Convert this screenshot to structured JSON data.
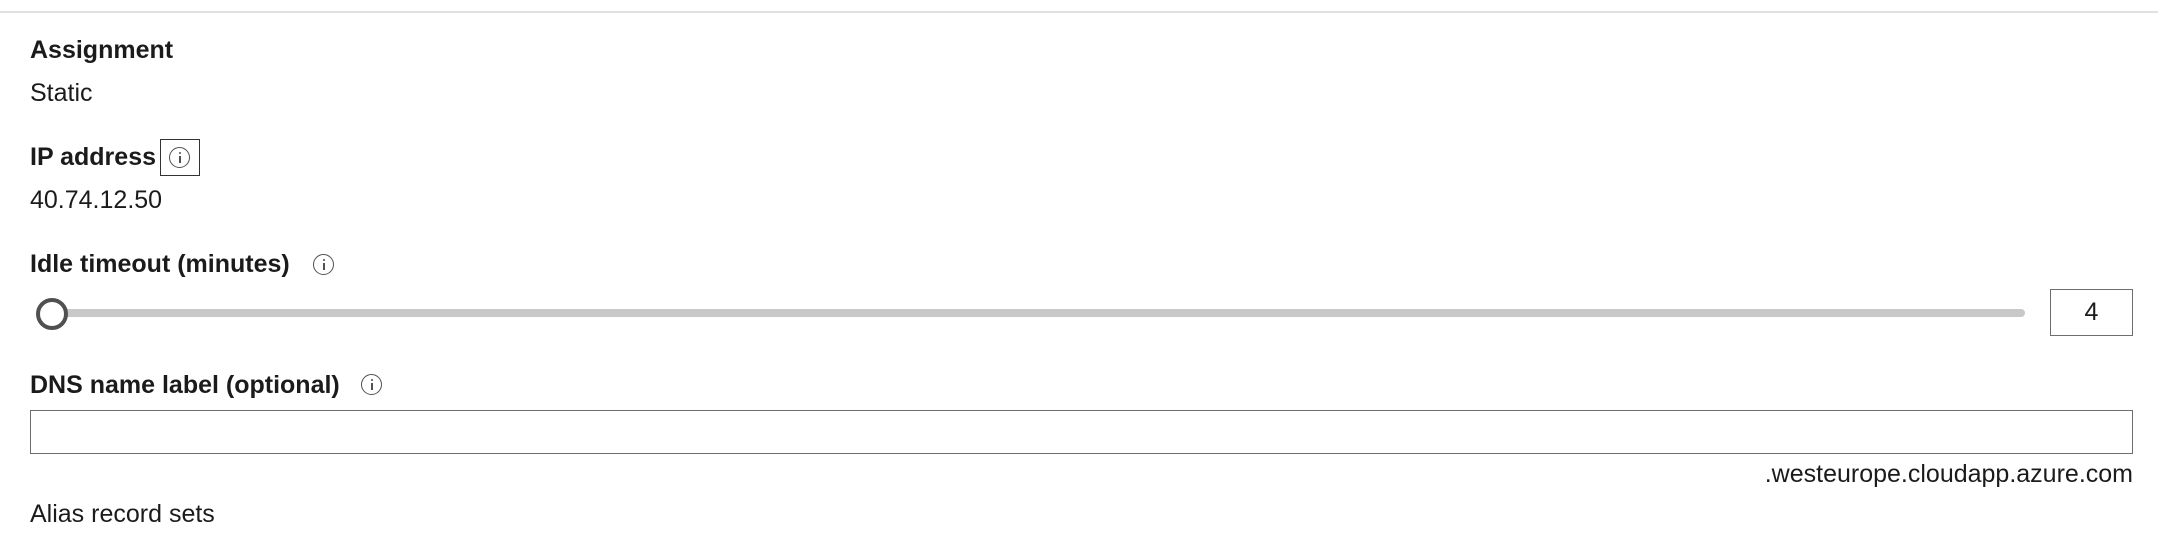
{
  "assignment": {
    "label": "Assignment",
    "value": "Static"
  },
  "ip_address": {
    "label": "IP address",
    "value": "40.74.12.50",
    "info_icon": "info-icon"
  },
  "idle_timeout": {
    "label": "Idle timeout (minutes)",
    "info_icon": "info-icon",
    "value": "4",
    "slider_level": 0
  },
  "dns_name_label": {
    "label": "DNS name label (optional)",
    "info_icon": "info-icon",
    "value": "",
    "placeholder": "",
    "suffix": ".westeurope.cloudapp.azure.com"
  },
  "alias_record_sets": {
    "label": "Alias record sets"
  }
}
